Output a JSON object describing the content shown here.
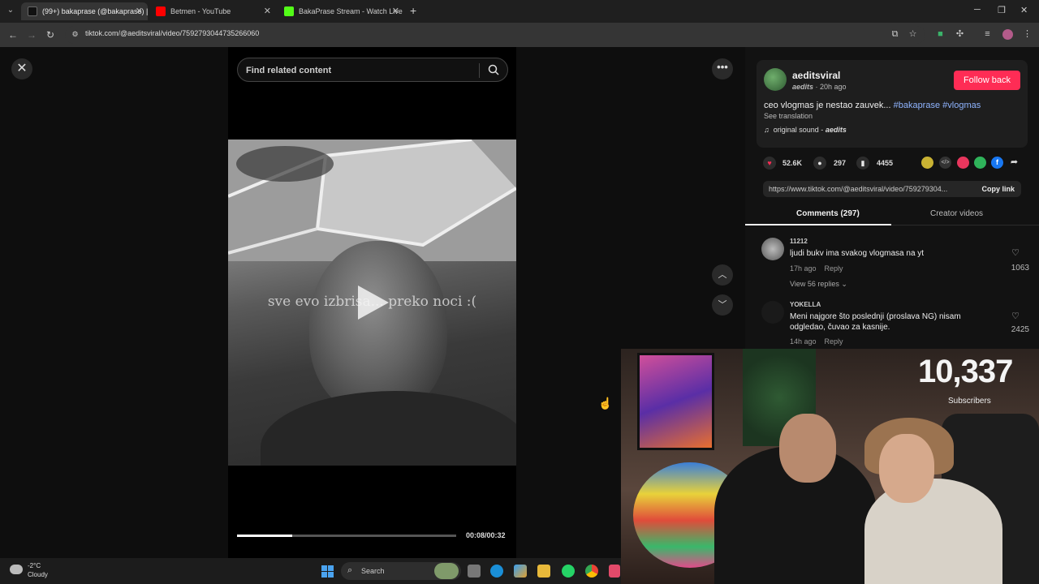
{
  "browser": {
    "tabs": [
      {
        "title": "(99+) bakaprase (@bakaprase) |",
        "favicon_color": "#111111",
        "active": true
      },
      {
        "title": "Betmen - YouTube",
        "favicon_color": "#ff0000",
        "active": false
      },
      {
        "title": "BakaPrase Stream - Watch Live",
        "favicon_color": "#53fc18",
        "active": false
      }
    ],
    "url": "tiktok.com/@aeditsviral/video/7592793044735266060"
  },
  "viewer": {
    "search_placeholder": "Find related content",
    "caption": "sve evo izbrisa... preko noci :(",
    "time": "00:08/00:32",
    "progress": 0.25
  },
  "post": {
    "username": "aeditsviral",
    "nickname": "aedits",
    "age": "20h ago",
    "follow_label": "Follow back",
    "description": "ceo vlogmas je nestao zauvek...",
    "tag1": "#bakaprase",
    "tag2": "#vlogmas",
    "see_translation": "See translation",
    "sound_prefix": "original sound -",
    "sound_author": "aedits",
    "likes": "52.6K",
    "comments": "297",
    "saves": "4455",
    "link": "https://www.tiktok.com/@aeditsviral/video/759279304...",
    "copy_label": "Copy link",
    "tab_comments": "Comments (297)",
    "tab_creator": "Creator videos"
  },
  "comments": [
    {
      "user": "11212",
      "text": "ljudi bukv ima svakog vlogmasa na yt",
      "age": "17h ago",
      "reply": "Reply",
      "likes": "1063",
      "replies": "View 56 replies"
    },
    {
      "user": "YOKELLA",
      "text": "Meni najgore što poslednji (proslava NG) nisam odgledao, čuvao za kasnije.",
      "age": "14h ago",
      "reply": "Reply",
      "likes": "2425"
    }
  ],
  "stream": {
    "subscribers": "10,337",
    "subscribers_label": "Subscribers"
  },
  "taskbar": {
    "temperature": "-2°C",
    "weather": "Cloudy",
    "search": "Search"
  },
  "colors": {
    "accent": "#fe2c55",
    "hashtag": "#8fb4ff"
  }
}
